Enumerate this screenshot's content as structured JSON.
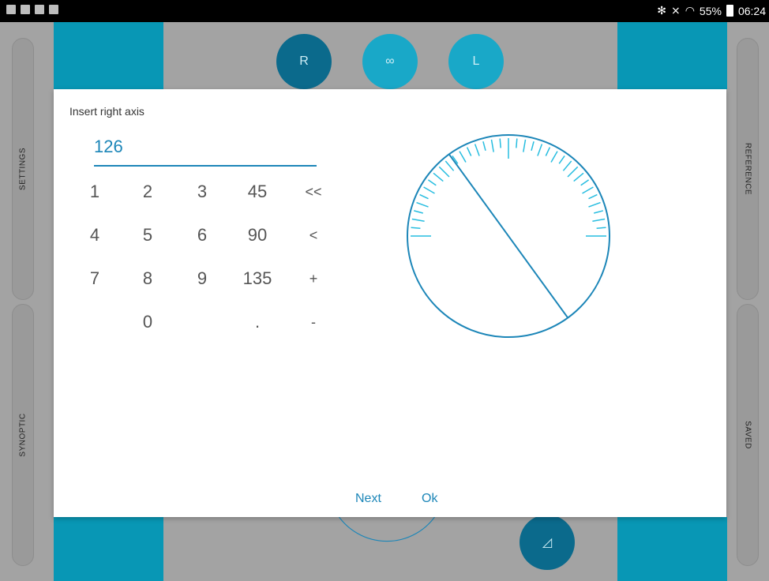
{
  "status_bar": {
    "notification_icons": [
      "screenshot-icon",
      "flipboard-icon",
      "flipboard-icon",
      "mail-icon"
    ],
    "bluetooth": "✻",
    "mute": "⨯",
    "wifi": "◠",
    "battery_text": "55%",
    "time": "06:24"
  },
  "side_tabs": {
    "settings": "SETTINGS",
    "synoptic": "SYNOPTIC",
    "reference": "REFERENCE",
    "saved": "SAVED"
  },
  "top_buttons": {
    "right": "R",
    "both": "∞",
    "left": "L"
  },
  "bottom_button_icon": "◿",
  "dialog": {
    "title": "Insert right axis",
    "input_value": "126",
    "keys": [
      [
        "1",
        "2",
        "3",
        "45",
        "<<"
      ],
      [
        "4",
        "5",
        "6",
        "90",
        "<"
      ],
      [
        "7",
        "8",
        "9",
        "135",
        "+"
      ],
      [
        "",
        "0",
        "",
        ".",
        "-"
      ]
    ],
    "axis_angle_deg": 126,
    "next_label": "Next",
    "ok_label": "Ok"
  },
  "colors": {
    "accent": "#1c86b8",
    "teal": "#0897b5",
    "dark_teal": "#0b6a8c",
    "light_teal": "#19a8c8",
    "dial_ticks": "#27bde0"
  }
}
